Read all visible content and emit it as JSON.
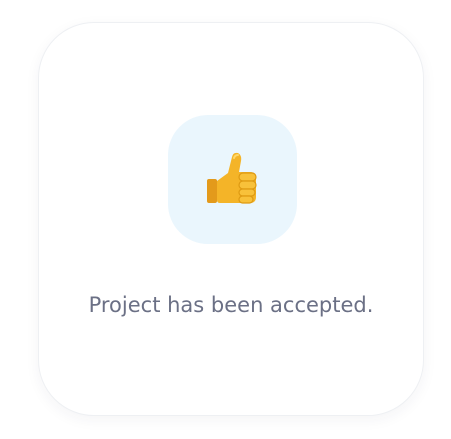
{
  "dialog": {
    "icon": "thumbs-up-icon",
    "message": "Project has been accepted.",
    "colors": {
      "icon_tile_background": "#eaf6fd",
      "message_text": "#6b7085",
      "thumb": "#f4b428"
    }
  }
}
